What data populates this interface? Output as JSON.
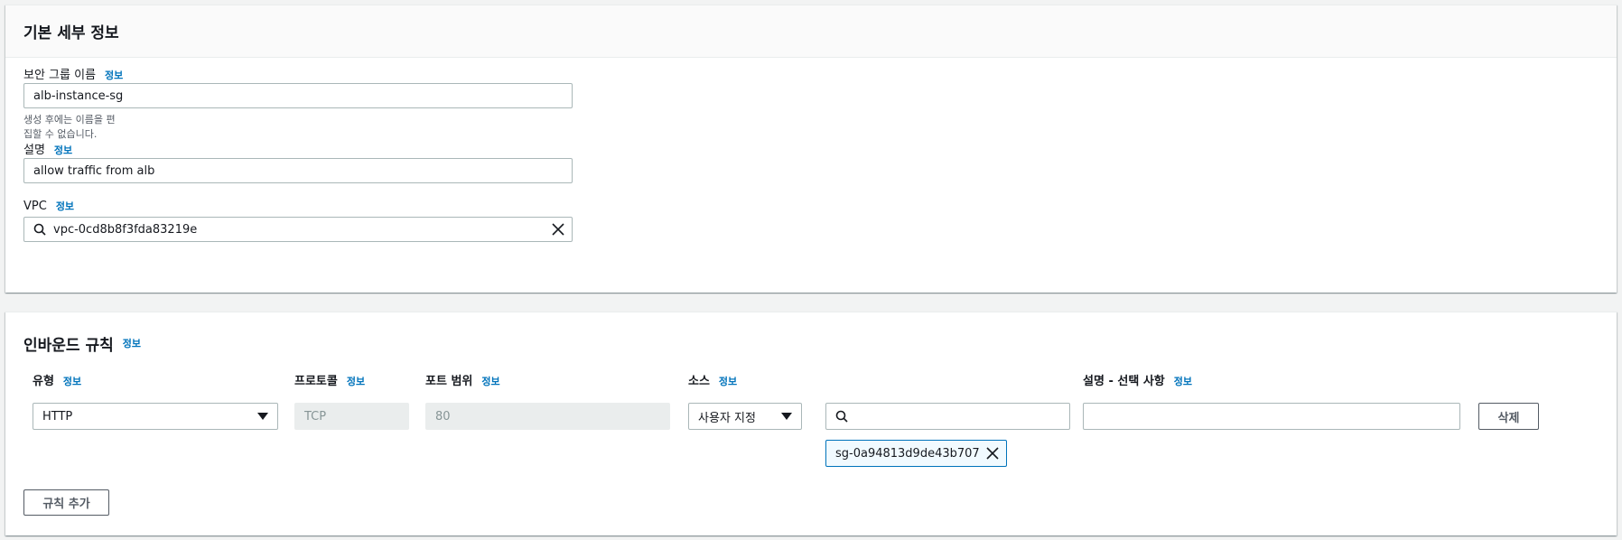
{
  "basic": {
    "title": "기본 세부 정보",
    "info": "정보",
    "sg_name": {
      "label": "보안 그룹 이름",
      "value": "alb-instance-sg",
      "hint": "생성 후에는 이름을 편집할 수 없습니다."
    },
    "description": {
      "label": "설명",
      "value": "allow traffic from alb"
    },
    "vpc": {
      "label": "VPC",
      "value": "vpc-0cd8b8f3fda83219e"
    }
  },
  "inbound": {
    "title": "인바운드 규칙",
    "info": "정보",
    "columns": {
      "type": "유형",
      "protocol": "프로토콜",
      "port": "포트 범위",
      "source": "소스",
      "desc": "설명 - 선택 사항"
    },
    "rule": {
      "type": "HTTP",
      "protocol": "TCP",
      "port": "80",
      "source_mode": "사용자 지정",
      "source_search": "",
      "source_token": "sg-0a94813d9de43b707",
      "description": "",
      "delete_label": "삭제"
    },
    "add_rule_label": "규칙 추가"
  },
  "icons": {
    "search": "search-icon",
    "clear": "close-icon",
    "dropdown": "caret-down-icon"
  }
}
